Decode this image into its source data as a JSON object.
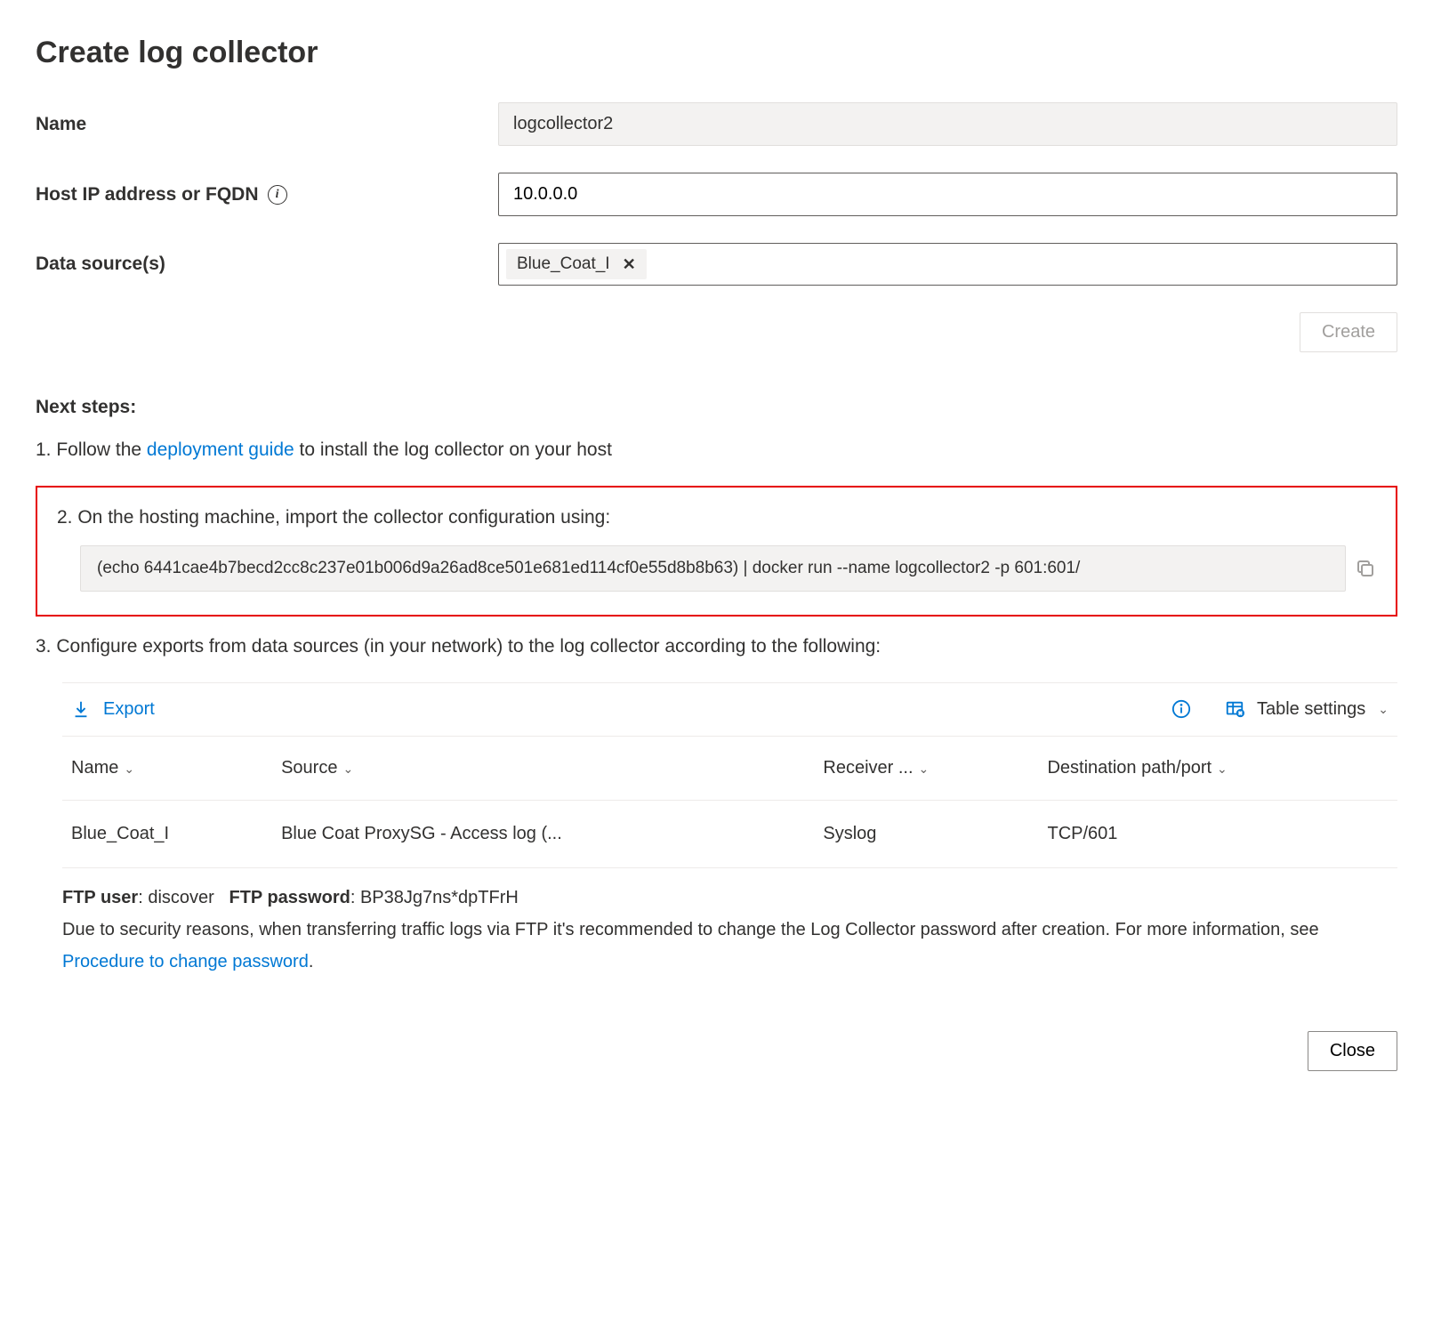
{
  "title": "Create log collector",
  "form": {
    "name_label": "Name",
    "name_value": "logcollector2",
    "host_label": "Host IP address or FQDN",
    "host_value": "10.0.0.0",
    "sources_label": "Data source(s)",
    "source_chip": "Blue_Coat_I"
  },
  "buttons": {
    "create": "Create",
    "close": "Close"
  },
  "next_steps_label": "Next steps:",
  "step1_prefix": "1. Follow the ",
  "step1_link": "deployment guide",
  "step1_suffix": " to install the log collector on your host",
  "step2": "2. On the hosting machine, import the collector configuration using:",
  "command": "(echo 6441cae4b7becd2cc8c237e01b006d9a26ad8ce501e681ed114cf0e55d8b8b63) | docker run --name logcollector2 -p 601:601/",
  "step3": "3. Configure exports from data sources (in your network) to the log collector according to the following:",
  "toolbar": {
    "export": "Export",
    "table_settings": "Table settings"
  },
  "table": {
    "headers": {
      "name": "Name",
      "source": "Source",
      "receiver": "Receiver ...",
      "dest": "Destination path/port"
    },
    "row": {
      "name": "Blue_Coat_I",
      "source": "Blue Coat ProxySG - Access log (...",
      "receiver": "Syslog",
      "dest": "TCP/601"
    }
  },
  "ftp": {
    "user_label": "FTP user",
    "user_value": "discover",
    "pass_label": "FTP password",
    "pass_value": "BP38Jg7ns*dpTFrH",
    "note_prefix": "Due to security reasons, when transferring traffic logs via FTP it's recommended to change the Log Collector password after creation. For more information, see ",
    "note_link": "Procedure to change password",
    "note_suffix": "."
  }
}
